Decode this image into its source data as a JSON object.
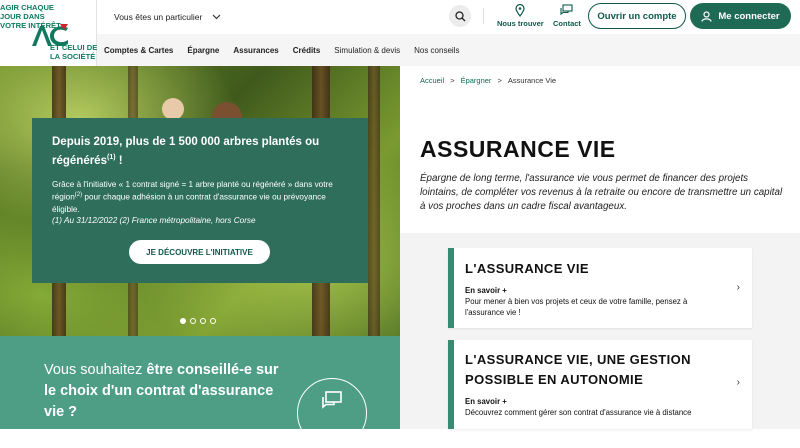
{
  "header": {
    "slogan_top": "AGIR CHAQUE JOUR DANS VOTRE INTÉRÊT",
    "slogan_bottom": "ET CELUI DE LA SOCIÉTÉ",
    "profile_select": "Vous êtes un particulier",
    "find_us": "Nous trouver",
    "contact": "Contact",
    "open_account": "Ouvrir un compte",
    "login": "Me connecter",
    "nav": [
      "Comptes & Cartes",
      "Épargne",
      "Assurances",
      "Crédits",
      "Simulation & devis",
      "Nos conseils"
    ]
  },
  "hero": {
    "title_main": "Depuis 2019, plus de 1 500 000 arbres plantés ou régénérés",
    "title_sup": "(1)",
    "title_end": " !",
    "text_1": "Grâce à l'initiative « 1 contrat signé = 1 arbre planté ou régénéré » dans votre région",
    "text_sup": "(2)",
    "text_2": " pour chaque adhésion à un contrat d'assurance vie ou prévoyance éligible.",
    "note": "(1) Au 31/12/2022 (2) France métropolitaine, hors Corse",
    "button": "JE DÉCOUVRE L'INITIATIVE",
    "slides": 4,
    "active_slide": 1
  },
  "advice": {
    "part1": "Vous souhaitez ",
    "bold": "être conseillé-e sur le choix d'un contrat d'assurance vie ?"
  },
  "breadcrumb": {
    "home": "Accueil",
    "savings": "Épargner",
    "current": "Assurance Vie"
  },
  "page": {
    "title": "ASSURANCE VIE",
    "intro": "Épargne de long terme, l'assurance vie vous permet de financer des projets lointains, de compléter vos revenus à la retraite ou encore de transmettre un capital à vos proches dans un cadre fiscal avantageux."
  },
  "cards": [
    {
      "title": "L'ASSURANCE VIE",
      "sub": "En savoir +",
      "desc": "Pour mener à bien vos projets et ceux de votre famille, pensez à l'assurance vie !"
    },
    {
      "title": "L'ASSURANCE VIE, UNE GESTION POSSIBLE EN AUTONOMIE",
      "sub": "En savoir +",
      "desc": "Découvrez comment gérer son contrat d'assurance vie à distance"
    }
  ],
  "colors": {
    "brand_green": "#0f5a4a",
    "card_green": "#2e6e5a",
    "advice_green": "#4d9e85"
  }
}
